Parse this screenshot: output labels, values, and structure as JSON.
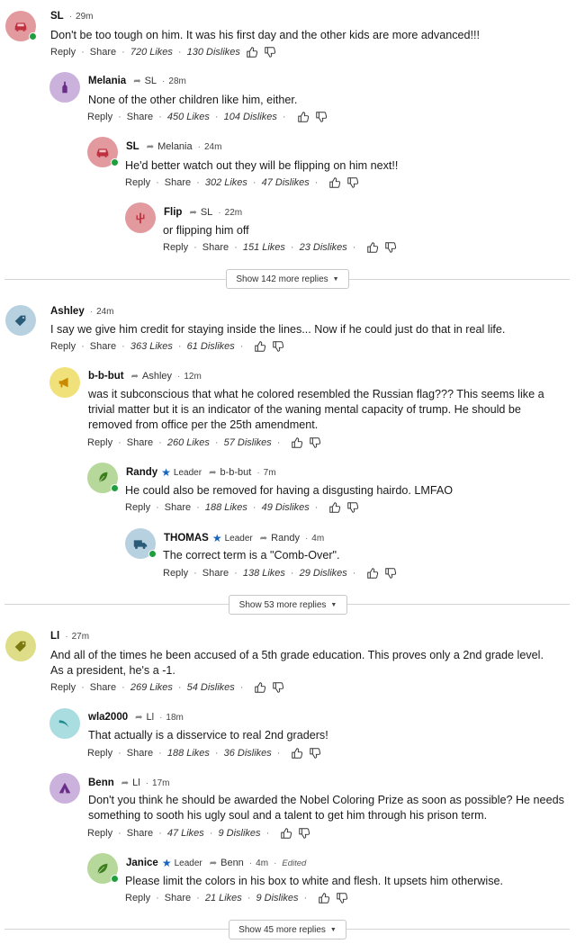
{
  "labels": {
    "reply": "Reply",
    "share": "Share",
    "leader": "Leader",
    "edited": "Edited"
  },
  "threads": [
    {
      "comments": [
        {
          "name": "SL",
          "time": "29m",
          "text": "Don't be too tough on him.  It was his first day and the other kids are more advanced!!!",
          "likes": "720 Likes",
          "dislikes": "130 Dislikes",
          "avatar_color": "#e29a9f",
          "icon": "car-icon",
          "online": true
        },
        {
          "name": "Melania",
          "reply_to": "SL",
          "time": "28m",
          "text": "None of the other children like him, either.",
          "likes": "450 Likes",
          "dislikes": "104 Dislikes",
          "avatar_color": "#cbb2dc",
          "icon": "bottle-icon",
          "online": false
        },
        {
          "name": "SL",
          "reply_to": "Melania",
          "time": "24m",
          "text": "He'd better watch out they will be flipping on him next!!",
          "likes": "302 Likes",
          "dislikes": "47 Dislikes",
          "avatar_color": "#e29a9f",
          "icon": "car-icon",
          "online": true
        },
        {
          "name": "Flip",
          "reply_to": "SL",
          "time": "22m",
          "text": "or flipping him off",
          "likes": "151 Likes",
          "dislikes": "23 Dislikes",
          "avatar_color": "#e29a9f",
          "icon": "cactus-icon",
          "online": false
        }
      ],
      "more_label": "Show 142 more replies"
    },
    {
      "comments": [
        {
          "name": "Ashley",
          "time": "24m",
          "text": "I say we give him credit for staying inside the lines... Now if he could just do that in real life.",
          "likes": "363 Likes",
          "dislikes": "61 Dislikes",
          "avatar_color": "#b7d1e0",
          "icon": "tag-icon",
          "online": false
        },
        {
          "name": "b-b-but",
          "reply_to": "Ashley",
          "time": "12m",
          "text": "was it subconscious that what he colored resembled the Russian flag???  This seems like a trivial matter but it is an indicator of the waning mental capacity of trump.  He should be removed from office per the 25th amendment.",
          "likes": "260 Likes",
          "dislikes": "57 Dislikes",
          "avatar_color": "#f0e17a",
          "icon": "megaphone-icon",
          "online": false
        },
        {
          "name": "Randy",
          "leader": true,
          "reply_to": "b-b-but",
          "time": "7m",
          "text": "He could also be removed for having a disgusting hairdo. LMFAO",
          "likes": "188 Likes",
          "dislikes": "49 Dislikes",
          "avatar_color": "#b6d89a",
          "icon": "feather-icon",
          "online": true
        },
        {
          "name": "THOMAS",
          "leader": true,
          "reply_to": "Randy",
          "time": "4m",
          "text": "The correct term is a \"Comb-Over\".",
          "likes": "138 Likes",
          "dislikes": "29 Dislikes",
          "avatar_color": "#b7d1e0",
          "icon": "truck-icon",
          "online": true
        }
      ],
      "more_label": "Show 53 more replies"
    },
    {
      "comments": [
        {
          "name": "Ll",
          "time": "27m",
          "text": "And all of the times he been accused of a 5th grade education. This proves only a 2nd grade level. As a president, he's a -1.",
          "likes": "269 Likes",
          "dislikes": "54 Dislikes",
          "avatar_color": "#dede88",
          "icon": "tag-icon",
          "online": false
        },
        {
          "name": "wla2000",
          "reply_to": "Ll",
          "time": "18m",
          "text": "That actually is a disservice to real 2nd graders!",
          "likes": "188 Likes",
          "dislikes": "36 Dislikes",
          "avatar_color": "#a9dde0",
          "icon": "boomerang-icon",
          "online": false
        },
        {
          "name": "Benn",
          "reply_to": "Ll",
          "time": "17m",
          "text": "Don't you think he should be awarded the Nobel Coloring Prize as soon as possible? He needs something to sooth his ugly soul and a talent to get him through his prison term.",
          "likes": "47 Likes",
          "dislikes": "9 Dislikes",
          "avatar_color": "#cbb2dc",
          "icon": "tent-icon",
          "online": false
        },
        {
          "name": "Janice",
          "leader": true,
          "reply_to": "Benn",
          "time": "4m",
          "edited": true,
          "text": "Please limit the colors in his box to white and flesh. It upsets him otherwise.",
          "likes": "21 Likes",
          "dislikes": "9 Dislikes",
          "avatar_color": "#b6d89a",
          "icon": "leaf-icon",
          "online": true
        }
      ],
      "more_label": "Show 45 more replies"
    }
  ]
}
